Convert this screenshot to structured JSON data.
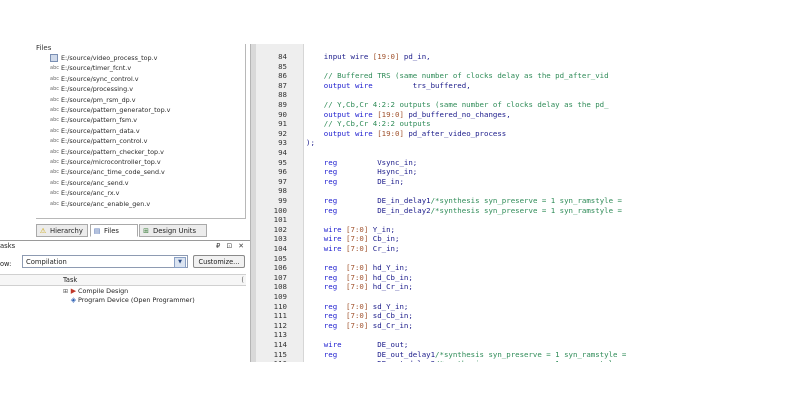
{
  "files_panel": {
    "header_label": "Files",
    "items": [
      {
        "icon": "verilog-file-icon",
        "label": "E:/source/video_process_top.v",
        "selected": true
      },
      {
        "icon": "verilog-file-icon",
        "label": "E:/source/timer_fcnt.v"
      },
      {
        "icon": "verilog-file-icon",
        "label": "E:/source/sync_control.v"
      },
      {
        "icon": "verilog-file-icon",
        "label": "E:/source/processing.v"
      },
      {
        "icon": "verilog-file-icon",
        "label": "E:/source/pm_rsm_dp.v"
      },
      {
        "icon": "verilog-file-icon",
        "label": "E:/source/pattern_generator_top.v"
      },
      {
        "icon": "verilog-file-icon",
        "label": "E:/source/pattern_fsm.v"
      },
      {
        "icon": "verilog-file-icon",
        "label": "E:/source/pattern_data.v"
      },
      {
        "icon": "verilog-file-icon",
        "label": "E:/source/pattern_control.v"
      },
      {
        "icon": "verilog-file-icon",
        "label": "E:/source/pattern_checker_top.v"
      },
      {
        "icon": "verilog-file-icon",
        "label": "E:/source/microcontroller_top.v"
      },
      {
        "icon": "verilog-file-icon",
        "label": "E:/source/anc_time_code_send.v"
      },
      {
        "icon": "verilog-file-icon",
        "label": "E:/source/anc_send.v"
      },
      {
        "icon": "verilog-file-icon",
        "label": "E:/source/anc_rx.v"
      },
      {
        "icon": "verilog-file-icon",
        "label": "E:/source/anc_enable_gen.v"
      }
    ]
  },
  "nav_tabs": [
    {
      "icon": "warning-icon",
      "glyph": "⚠",
      "label": "Hierarchy",
      "active": false
    },
    {
      "icon": "files-icon",
      "glyph": "▤",
      "label": "Files",
      "active": true
    },
    {
      "icon": "design-units-icon",
      "glyph": "⊞",
      "label": "Design Units",
      "active": false
    }
  ],
  "tasks_panel": {
    "title": "asks",
    "controls": "₽ ⊡ ✕",
    "flow_label": "ow:",
    "flow_value": "Compilation",
    "flow_dropdown_glyph": "▼",
    "customize_label": "Customize...",
    "column_task": "Task",
    "column_right": "(",
    "rows": [
      {
        "expand": "⊞",
        "arrow": "▶",
        "arrow_color": "#c0392b",
        "label": "Compile Design"
      },
      {
        "expand": "",
        "arrow": "◈",
        "arrow_color": "#2b5fb3",
        "label": "Program Device (Open Programmer)"
      }
    ]
  },
  "editor": {
    "lines": [
      {
        "n": "84",
        "parts": [
          [
            "tx",
            "    input wire "
          ],
          [
            "nm",
            "[19:0]"
          ],
          [
            "tx",
            " pd_in,"
          ]
        ]
      },
      {
        "n": "85",
        "parts": []
      },
      {
        "n": "86",
        "parts": [
          [
            "cm",
            "    // Buffered TRS (same number of clocks delay as the pd_after_vid"
          ]
        ]
      },
      {
        "n": "87",
        "parts": [
          [
            "kw",
            "    output wire"
          ],
          [
            "tx",
            "         trs_buffered,"
          ]
        ]
      },
      {
        "n": "88",
        "parts": []
      },
      {
        "n": "89",
        "parts": [
          [
            "cm",
            "    // Y,Cb,Cr 4:2:2 outputs (same number of clocks delay as the pd_"
          ]
        ]
      },
      {
        "n": "90",
        "parts": [
          [
            "kw",
            "    output wire "
          ],
          [
            "nm",
            "[19:0]"
          ],
          [
            "tx",
            " pd_buffered_no_changes,"
          ]
        ]
      },
      {
        "n": "91",
        "parts": [
          [
            "cm",
            "    // Y,Cb,Cr 4:2:2 outputs"
          ]
        ]
      },
      {
        "n": "92",
        "parts": [
          [
            "kw",
            "    output wire "
          ],
          [
            "nm",
            "[19:0]"
          ],
          [
            "tx",
            " pd_after_video_process"
          ]
        ]
      },
      {
        "n": "93",
        "parts": [
          [
            "tx",
            ");"
          ]
        ]
      },
      {
        "n": "94",
        "parts": []
      },
      {
        "n": "95",
        "parts": [
          [
            "kw",
            "    reg"
          ],
          [
            "tx",
            "         Vsync_in;"
          ]
        ]
      },
      {
        "n": "96",
        "parts": [
          [
            "kw",
            "    reg"
          ],
          [
            "tx",
            "         Hsync_in;"
          ]
        ]
      },
      {
        "n": "97",
        "parts": [
          [
            "kw",
            "    reg"
          ],
          [
            "tx",
            "         DE_in;"
          ]
        ]
      },
      {
        "n": "98",
        "parts": []
      },
      {
        "n": "99",
        "parts": [
          [
            "kw",
            "    reg"
          ],
          [
            "tx",
            "         DE_in_delay1"
          ],
          [
            "cm",
            "/*synthesis syn_preserve = 1 syn_ramstyle ="
          ]
        ]
      },
      {
        "n": "100",
        "parts": [
          [
            "kw",
            "    reg"
          ],
          [
            "tx",
            "         DE_in_delay2"
          ],
          [
            "cm",
            "/*synthesis syn_preserve = 1 syn_ramstyle ="
          ]
        ]
      },
      {
        "n": "101",
        "parts": []
      },
      {
        "n": "102",
        "parts": [
          [
            "kw",
            "    wire "
          ],
          [
            "nm",
            "[7:0]"
          ],
          [
            "tx",
            " Y_in;"
          ]
        ]
      },
      {
        "n": "103",
        "parts": [
          [
            "kw",
            "    wire "
          ],
          [
            "nm",
            "[7:0]"
          ],
          [
            "tx",
            " Cb_in;"
          ]
        ]
      },
      {
        "n": "104",
        "parts": [
          [
            "kw",
            "    wire "
          ],
          [
            "nm",
            "[7:0]"
          ],
          [
            "tx",
            " Cr_in;"
          ]
        ]
      },
      {
        "n": "105",
        "parts": []
      },
      {
        "n": "106",
        "parts": [
          [
            "kw",
            "    reg  "
          ],
          [
            "nm",
            "[7:0]"
          ],
          [
            "tx",
            " hd_Y_in;"
          ]
        ]
      },
      {
        "n": "107",
        "parts": [
          [
            "kw",
            "    reg  "
          ],
          [
            "nm",
            "[7:0]"
          ],
          [
            "tx",
            " hd_Cb_in;"
          ]
        ]
      },
      {
        "n": "108",
        "parts": [
          [
            "kw",
            "    reg  "
          ],
          [
            "nm",
            "[7:0]"
          ],
          [
            "tx",
            " hd_Cr_in;"
          ]
        ]
      },
      {
        "n": "109",
        "parts": []
      },
      {
        "n": "110",
        "parts": [
          [
            "kw",
            "    reg  "
          ],
          [
            "nm",
            "[7:0]"
          ],
          [
            "tx",
            " sd_Y_in;"
          ]
        ]
      },
      {
        "n": "111",
        "parts": [
          [
            "kw",
            "    reg  "
          ],
          [
            "nm",
            "[7:0]"
          ],
          [
            "tx",
            " sd_Cb_in;"
          ]
        ]
      },
      {
        "n": "112",
        "parts": [
          [
            "kw",
            "    reg  "
          ],
          [
            "nm",
            "[7:0]"
          ],
          [
            "tx",
            " sd_Cr_in;"
          ]
        ]
      },
      {
        "n": "113",
        "parts": []
      },
      {
        "n": "114",
        "parts": [
          [
            "kw",
            "    wire"
          ],
          [
            "tx",
            "        DE_out;"
          ]
        ]
      },
      {
        "n": "115",
        "parts": [
          [
            "kw",
            "    reg"
          ],
          [
            "tx",
            "         DE_out_delay1"
          ],
          [
            "cm",
            "/*synthesis syn_preserve = 1 syn_ramstyle ="
          ]
        ]
      },
      {
        "n": "116",
        "parts": [
          [
            "kw",
            "    reg"
          ],
          [
            "tx",
            "         DE_out_delay2"
          ],
          [
            "cm",
            "/*synthesis syn_preserve = 1 syn_ramstyle ="
          ]
        ]
      }
    ]
  }
}
